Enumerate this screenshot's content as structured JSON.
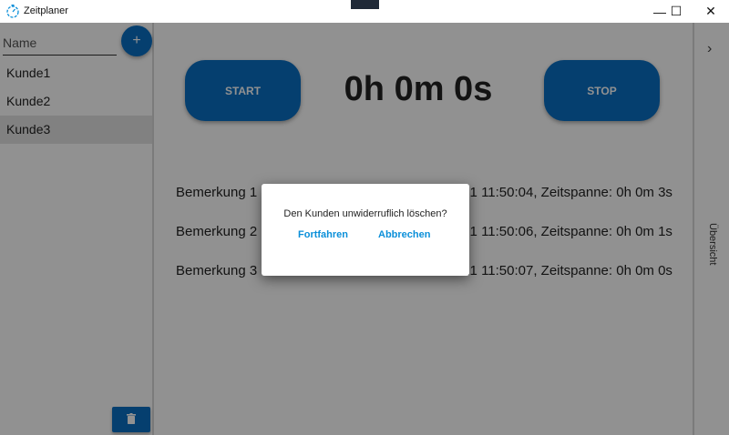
{
  "window": {
    "title": "Zeitplaner",
    "controls": {
      "minimize": "—",
      "maximize": "☐",
      "close": "✕"
    }
  },
  "sidebar": {
    "name_placeholder": "Name",
    "add_label": "+",
    "customers": [
      "Kunde1",
      "Kunde2",
      "Kunde3"
    ],
    "selected_index": 2,
    "delete_icon": "trash-icon"
  },
  "timer": {
    "start_label": "START",
    "stop_label": "STOP",
    "display": "0h 0m 0s"
  },
  "log": [
    {
      "visible_prefix": "Bemerkung 1",
      "visible_suffix": "21 11:50:04, Zeitspanne: 0h 0m 3s"
    },
    {
      "visible_prefix": "Bemerkung 2",
      "visible_suffix": "21 11:50:06, Zeitspanne: 0h 0m 1s"
    },
    {
      "visible_prefix": "Bemerkung 3",
      "visible_suffix": "21 11:50:07, Zeitspanne: 0h 0m 0s"
    }
  ],
  "right_panel": {
    "expand_icon": "chevron-right-icon",
    "tab_label": "Übersicht"
  },
  "dialog": {
    "message": "Den Kunden unwiderruflich löschen?",
    "confirm_label": "Fortfahren",
    "cancel_label": "Abbrechen"
  },
  "colors": {
    "accent": "#0a6fc4",
    "dialog_link": "#0a8fd9",
    "overlay": "rgba(0,0,0,0.43)"
  }
}
